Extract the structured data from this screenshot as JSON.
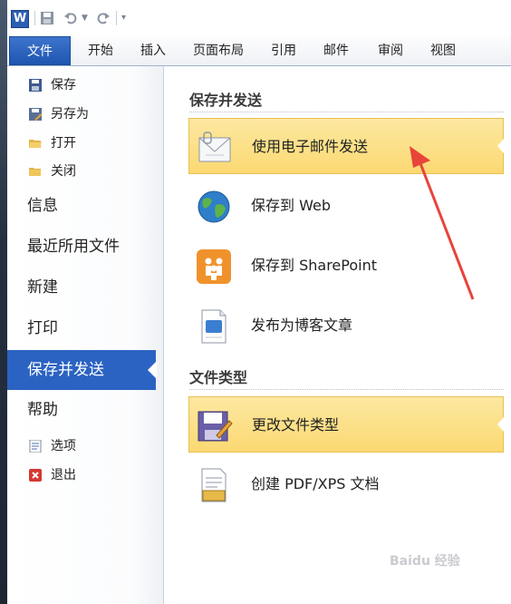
{
  "app": {
    "logo": "W"
  },
  "tabs": [
    "文件",
    "开始",
    "插入",
    "页面布局",
    "引用",
    "邮件",
    "审阅",
    "视图"
  ],
  "nav": {
    "small_top": [
      {
        "label": "保存",
        "icon": "save-icon"
      },
      {
        "label": "另存为",
        "icon": "save-as-icon"
      },
      {
        "label": "打开",
        "icon": "open-folder-icon"
      },
      {
        "label": "关闭",
        "icon": "close-folder-icon"
      }
    ],
    "big": [
      "信息",
      "最近所用文件",
      "新建",
      "打印",
      "保存并发送",
      "帮助"
    ],
    "small_bottom": [
      {
        "label": "选项",
        "icon": "options-icon"
      },
      {
        "label": "退出",
        "icon": "exit-icon"
      }
    ]
  },
  "main": {
    "section1": "保存并发送",
    "items1": [
      {
        "label": "使用电子邮件发送",
        "icon": "email-icon",
        "selected": true
      },
      {
        "label": "保存到 Web",
        "icon": "globe-icon"
      },
      {
        "label": "保存到 SharePoint",
        "icon": "sharepoint-icon"
      },
      {
        "label": "发布为博客文章",
        "icon": "blog-icon"
      }
    ],
    "section2": "文件类型",
    "items2": [
      {
        "label": "更改文件类型",
        "icon": "change-file-type-icon",
        "selected": true
      },
      {
        "label": "创建 PDF/XPS 文档",
        "icon": "pdf-document-icon"
      }
    ]
  },
  "watermark": "Baidu 经验",
  "colors": {
    "accent": "#2b63c2",
    "selected_bg": "#fbd972",
    "annotation_arrow": "#e8443a"
  }
}
